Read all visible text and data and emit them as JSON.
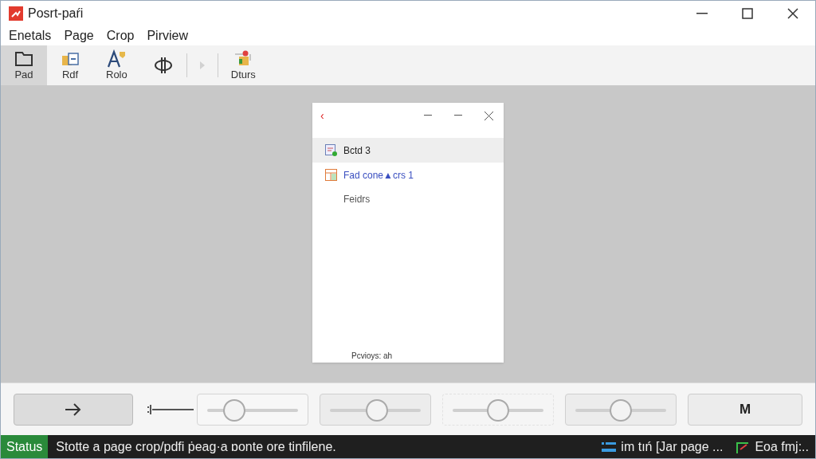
{
  "window": {
    "title": "Posrt-paŕi"
  },
  "menu": [
    "Enetals",
    "Page",
    "Crop",
    "Pirview"
  ],
  "toolbar": [
    {
      "kind": "button",
      "label": "Pad",
      "selected": true
    },
    {
      "kind": "button",
      "label": "Rdf",
      "selected": false
    },
    {
      "kind": "button",
      "label": "Rolo",
      "selected": false
    },
    {
      "kind": "button",
      "selected": false
    },
    {
      "kind": "separator"
    },
    {
      "kind": "button",
      "disabled": true,
      "selected": false
    },
    {
      "kind": "separator"
    },
    {
      "kind": "button",
      "label": "Dturs",
      "selected": false
    }
  ],
  "dialog": {
    "back": "‹",
    "items": [
      {
        "label": "Bctd 3",
        "kind": "doc",
        "selected": true
      },
      {
        "label": "Fad cone▲crs 1",
        "kind": "table",
        "selected": false
      }
    ],
    "note": "Feidrs",
    "footer": "Pcvioys: ah"
  },
  "controls": [
    {
      "kind": "arrow-button"
    },
    {
      "kind": "split-slider",
      "level": 0.3
    },
    {
      "kind": "filled-slider",
      "level": 0.52
    },
    {
      "kind": "slider",
      "level": 0.5
    },
    {
      "kind": "filled-slider",
      "level": 0.5
    },
    {
      "kind": "text-button",
      "label": "M"
    }
  ],
  "status_bar": {
    "label": "Status",
    "message": "Stotte a page crop/pdfi ṗeag·a ɒonte ore tinfilene.",
    "items": [
      {
        "text": "im tıń [Jar page ..."
      },
      {
        "text": "Eoa fmj:.."
      }
    ]
  }
}
